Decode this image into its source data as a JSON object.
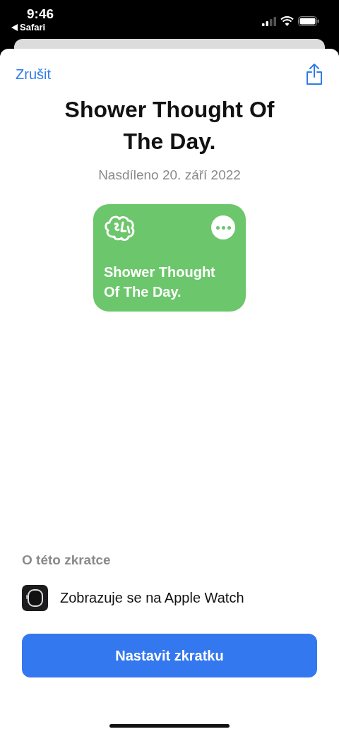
{
  "status_bar": {
    "time": "9:46",
    "back_label": "Safari"
  },
  "nav": {
    "cancel": "Zrušit"
  },
  "title": "Shower Thought Of The Day.",
  "shared_date": "Nasdíleno 20. září 2022",
  "shortcut_card": {
    "title": "Shower Thought Of The Day.",
    "color": "#6cc66b"
  },
  "about": {
    "heading": "O této zkratce",
    "items": [
      {
        "kind": "watch",
        "label": "Zobrazuje se na Apple Watch"
      }
    ]
  },
  "primary_button": "Nastavit zkratku"
}
